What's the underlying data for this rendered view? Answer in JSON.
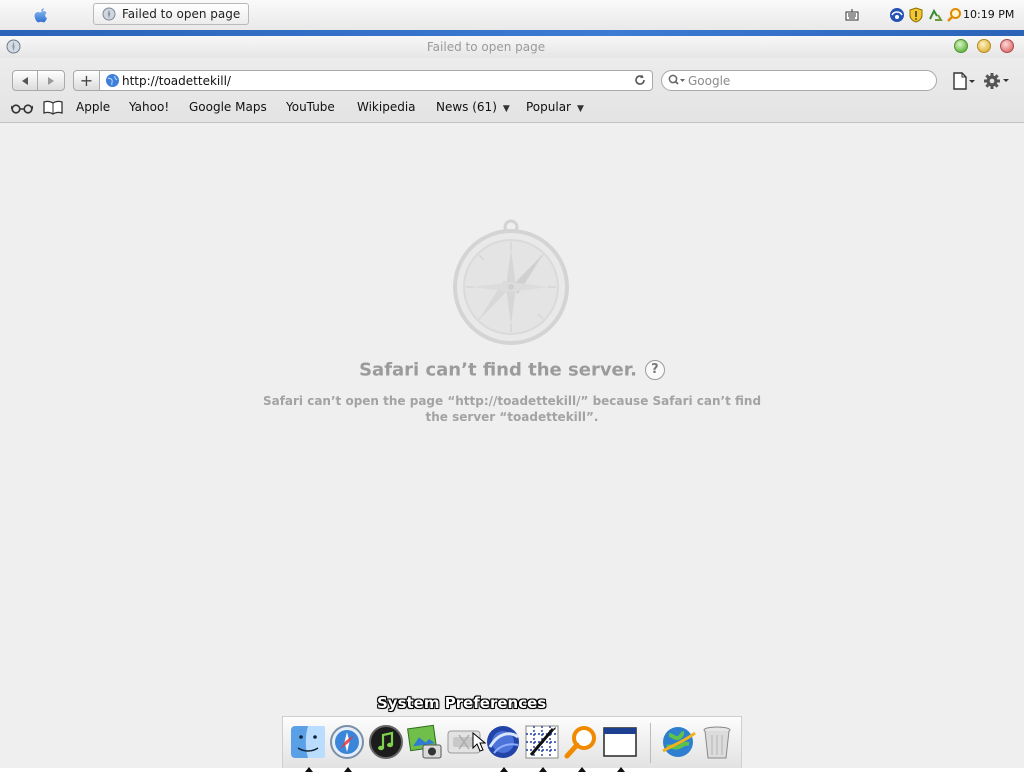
{
  "taskbar": {
    "apple_menu_icon": "apple-icon",
    "task_button": {
      "label": "Failed to open page",
      "icon": "safari-compass-icon"
    },
    "tray_icons": [
      "keyboard-icon",
      "network-icon",
      "shield-icon",
      "recycle-icon",
      "search-icon"
    ],
    "clock": "10:19 PM"
  },
  "window": {
    "title": "Failed to open page",
    "controls": [
      "zoom",
      "minimize",
      "close"
    ]
  },
  "toolbar": {
    "address": {
      "value": "http://toadettekill/"
    },
    "search": {
      "placeholder": "Google"
    },
    "add_bookmark_label": "+",
    "back_label": "◀",
    "forward_label": "▶"
  },
  "bookmarks": [
    {
      "label": "Apple"
    },
    {
      "label": "Yahoo!"
    },
    {
      "label": "Google Maps"
    },
    {
      "label": "YouTube"
    },
    {
      "label": "Wikipedia"
    },
    {
      "label": "News (61)",
      "menu": true
    },
    {
      "label": "Popular",
      "menu": true
    }
  ],
  "error": {
    "title": "Safari can’t find the server.",
    "help_label": "?",
    "message": "Safari can’t open the page “http://toadettekill/” because Safari can’t find the server “toadettekill”."
  },
  "dock": {
    "hover_label": "System Preferences",
    "items": [
      {
        "name": "finder",
        "running": true
      },
      {
        "name": "safari",
        "running": true
      },
      {
        "name": "itunes",
        "running": false
      },
      {
        "name": "iphoto",
        "running": false
      },
      {
        "name": "system-preferences",
        "running": false
      },
      {
        "name": "internet-explorer",
        "running": true
      },
      {
        "name": "pen-tool",
        "running": true
      },
      {
        "name": "magnifier",
        "running": true
      },
      {
        "name": "window-app",
        "running": true
      },
      {
        "name": "network-globe",
        "running": false
      },
      {
        "name": "trash",
        "running": false
      }
    ]
  },
  "colors": {
    "accent_strip": "#2a63b8",
    "content_bg": "#efefef",
    "error_text": "#9b9b9b"
  }
}
